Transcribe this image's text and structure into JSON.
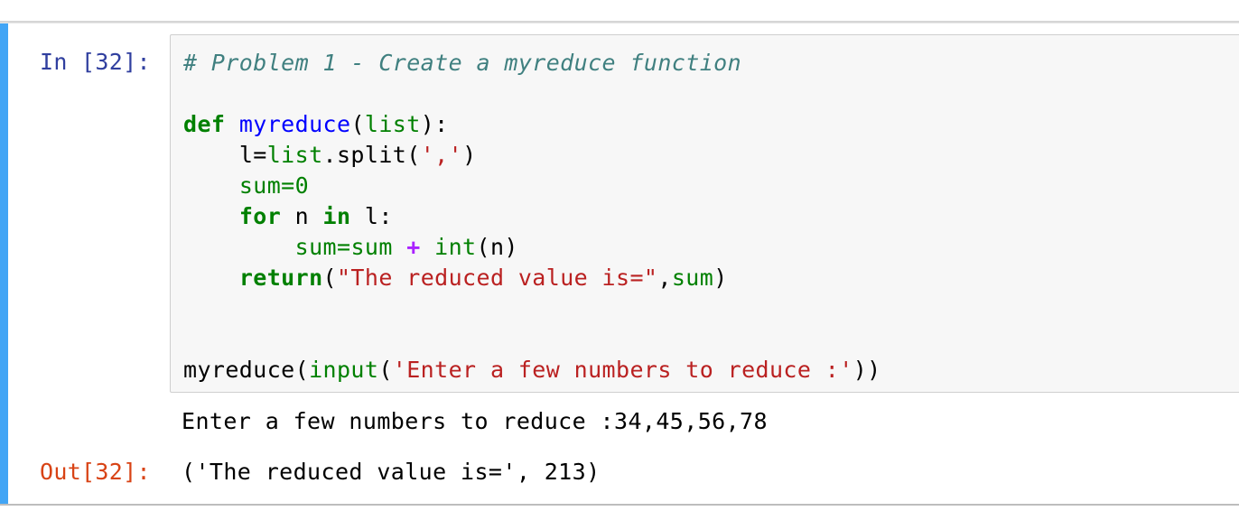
{
  "cell": {
    "in_prompt": "In [32]:",
    "out_prompt": "Out[32]:",
    "code": {
      "line1_comment": "# Problem 1 - Create a myreduce function",
      "line2": "",
      "line3_def": "def",
      "line3_space": " ",
      "line3_fn": "myreduce",
      "line3_paren_open": "(",
      "line3_param": "list",
      "line3_rest": "):",
      "line4_indent": "    ",
      "line4_var": "l=",
      "line4_list": "list",
      "line4_mid": ".split(",
      "line4_str": "','",
      "line4_end": ")",
      "line5_indent": "    ",
      "line5_var": "sum",
      "line5_eq": "=",
      "line5_num": "0",
      "line6_indent": "    ",
      "line6_for": "for",
      "line6_mid": " n ",
      "line6_in": "in",
      "line6_end": " l:",
      "line7_indent": "        ",
      "line7_sum1": "sum",
      "line7_eq": "=",
      "line7_sum2": "sum",
      "line7_sp1": " ",
      "line7_plus": "+",
      "line7_sp2": " ",
      "line7_int": "int",
      "line7_end": "(n)",
      "line8_indent": "    ",
      "line8_return": "return",
      "line8_paren": "(",
      "line8_str": "\"The reduced value is=\"",
      "line8_comma": ",",
      "line8_sum": "sum",
      "line8_end": ")",
      "line11_call": "myreduce(",
      "line11_input": "input",
      "line11_paren": "(",
      "line11_str": "'Enter a few numbers to reduce :'",
      "line11_end": "))"
    },
    "stdout": "Enter a few numbers to reduce :34,45,56,78",
    "result": "('The reduced value is=', 213)"
  },
  "colors": {
    "selected_bar": "#42a5f5",
    "in_prompt": "#303f9f",
    "out_prompt": "#d84315"
  }
}
